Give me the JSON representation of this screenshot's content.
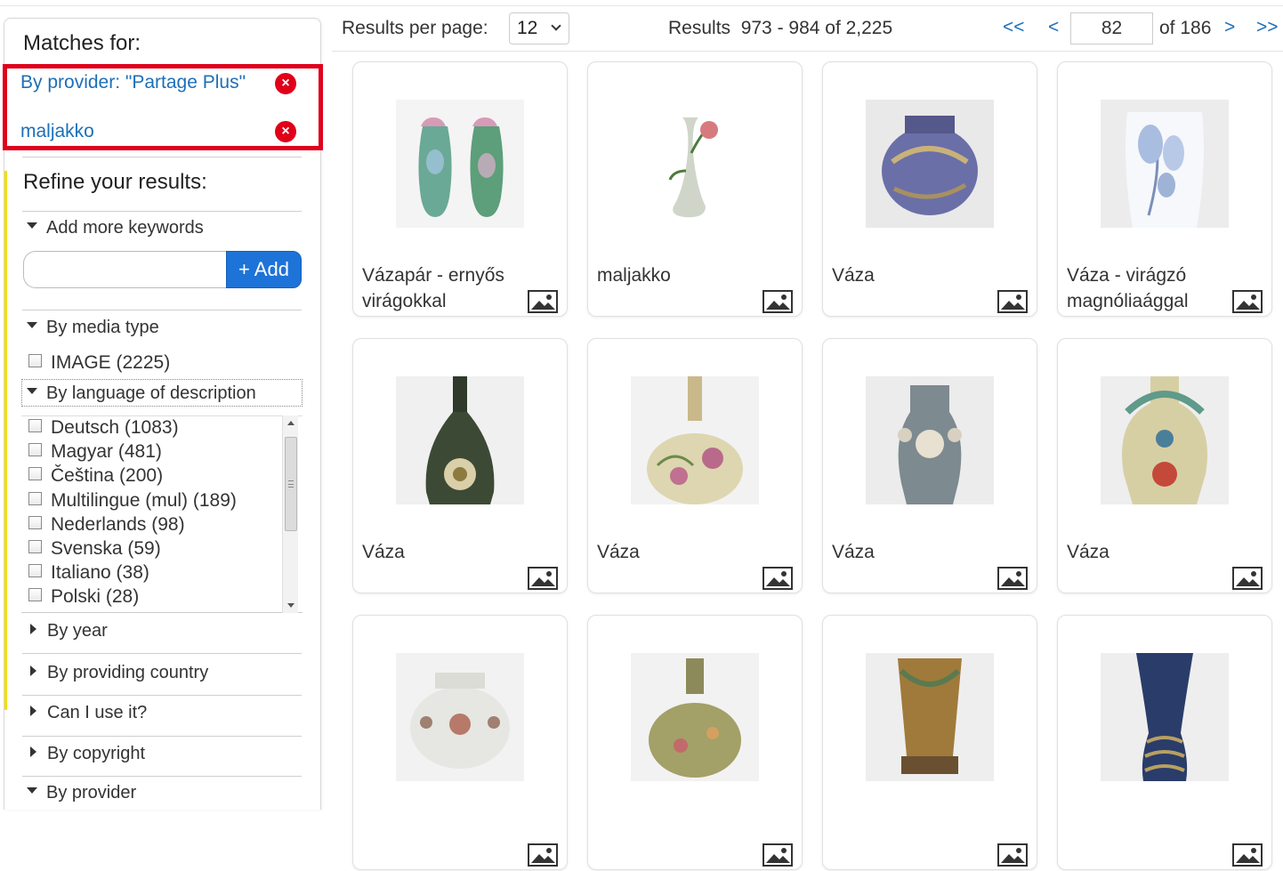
{
  "sidebar": {
    "matches_title": "Matches for:",
    "active_filters": [
      {
        "label": "By provider: \"Partage Plus\"",
        "remove": "×"
      },
      {
        "label": "maljakko",
        "remove": "×"
      }
    ],
    "refine_title": "Refine your results:",
    "keywords_head": "Add more keywords",
    "keywords_placeholder": "",
    "add_label": "+ Add",
    "media_head": "By media type",
    "media_options": [
      "IMAGE (2225)"
    ],
    "language_head": "By language of description",
    "language_options": [
      "Deutsch (1083)",
      "Magyar (481)",
      "Čeština (200)",
      "Multilingue (mul) (189)",
      "Nederlands (98)",
      "Svenska (59)",
      "Italiano (38)",
      "Polski (28)"
    ],
    "collapsed_sections": [
      "By year",
      "By providing country",
      "Can I use it?",
      "By copyright",
      "By provider"
    ]
  },
  "toolbar": {
    "per_page_label": "Results per page:",
    "per_page_value": "12",
    "results_text": "Results  973 - 984 of 2,225",
    "first": "<<",
    "prev": "<",
    "page": "82",
    "of_pages": "of 186",
    "next": ">",
    "last": ">>"
  },
  "results": [
    {
      "title": "Vázapár - ernyős virágokkal"
    },
    {
      "title": "maljakko"
    },
    {
      "title": "Váza"
    },
    {
      "title": "Váza - virágzó magnóliaággal"
    },
    {
      "title": "Váza"
    },
    {
      "title": "Váza"
    },
    {
      "title": "Váza"
    },
    {
      "title": "Váza"
    },
    {
      "title": ""
    },
    {
      "title": ""
    },
    {
      "title": ""
    },
    {
      "title": ""
    }
  ],
  "colors": {
    "link": "#1d6fb8",
    "accent": "#1e73d8",
    "highlight": "#e0001a"
  }
}
